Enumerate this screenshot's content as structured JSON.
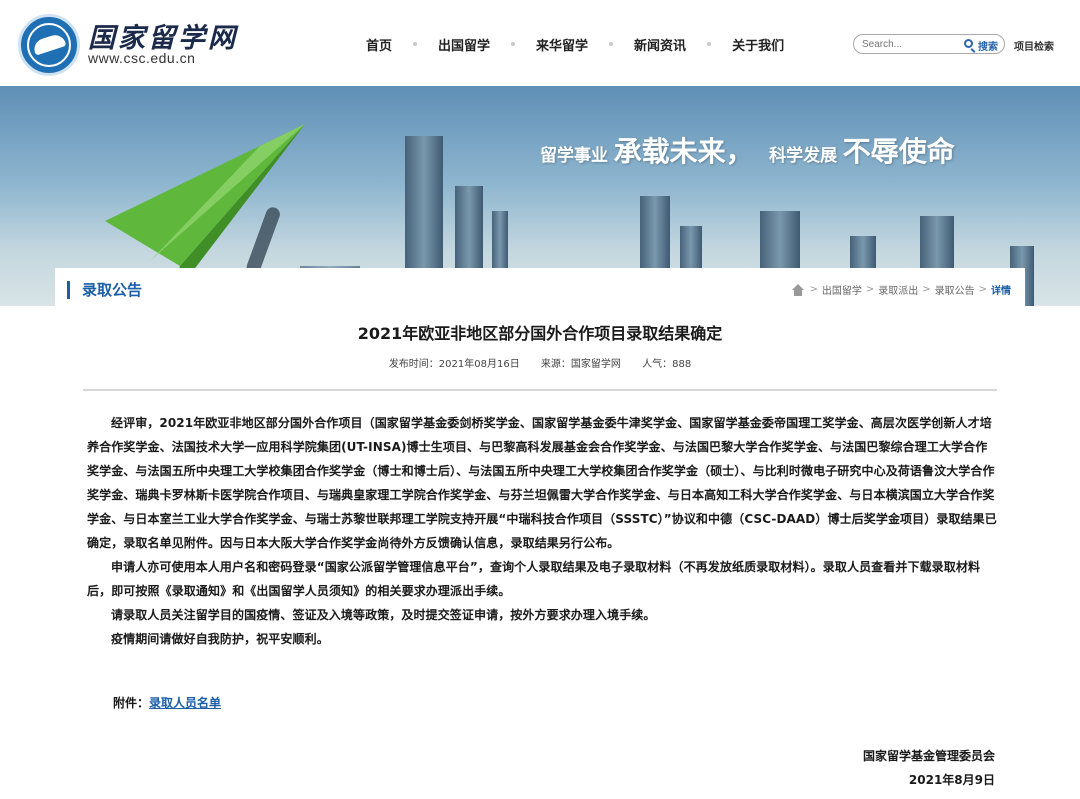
{
  "header": {
    "logo_title": "国家留学网",
    "logo_url": "www.csc.edu.cn",
    "nav": [
      "首页",
      "出国留学",
      "来华留学",
      "新闻资讯",
      "关于我们"
    ],
    "search_placeholder": "Search...",
    "search_button": "搜索",
    "project_search": "项目检索"
  },
  "banner": {
    "slogan_1": "留学事业",
    "slogan_2": "承载未来，",
    "slogan_3": "科学发展",
    "slogan_4": "不辱使命"
  },
  "section": {
    "title": "录取公告",
    "breadcrumb": [
      "出国留学",
      "录取派出",
      "录取公告",
      "详情"
    ]
  },
  "article": {
    "title": "2021年欧亚非地区部分国外合作项目录取结果确定",
    "meta": {
      "publish_time": "发布时间：2021年08月16日",
      "source": "来源：国家留学网",
      "views": "人气：888"
    },
    "paragraphs": [
      "经评审，2021年欧亚非地区部分国外合作项目（国家留学基金委剑桥奖学金、国家留学基金委牛津奖学金、国家留学基金委帝国理工奖学金、高层次医学创新人才培养合作奖学金、法国技术大学一应用科学院集团(UT-INSA)博士生项目、与巴黎高科发展基金会合作奖学金、与法国巴黎大学合作奖学金、与法国巴黎综合理工大学合作奖学金、与法国五所中央理工大学校集团合作奖学金（博士和博士后）、与法国五所中央理工大学校集团合作奖学金（硕士）、与比利时微电子研究中心及荷语鲁汶大学合作奖学金、瑞典卡罗林斯卡医学院合作项目、与瑞典皇家理工学院合作奖学金、与芬兰坦佩雷大学合作奖学金、与日本高知工科大学合作奖学金、与日本横滨国立大学合作奖学金、与日本室兰工业大学合作奖学金、与瑞士苏黎世联邦理工学院支持开展“中瑞科技合作项目（SSSTC）”协议和中德（CSC-DAAD）博士后奖学金项目）录取结果已确定，录取名单见附件。因与日本大阪大学合作奖学金尚待外方反馈确认信息，录取结果另行公布。",
      "申请人亦可使用本人用户名和密码登录“国家公派留学管理信息平台”，查询个人录取结果及电子录取材料（不再发放纸质录取材料）。录取人员查看并下载录取材料后，即可按照《录取通知》和《出国留学人员须知》的相关要求办理派出手续。",
      "请录取人员关注留学目的国疫情、签证及入境等政策，及时提交签证申请，按外方要求办理入境手续。",
      "疫情期间请做好自我防护，祝平安顺利。"
    ],
    "attachment_label": "附件：",
    "attachment_link": "录取人员名单",
    "signoff_org": "国家留学基金管理委员会",
    "signoff_date": "2021年8月9日"
  }
}
